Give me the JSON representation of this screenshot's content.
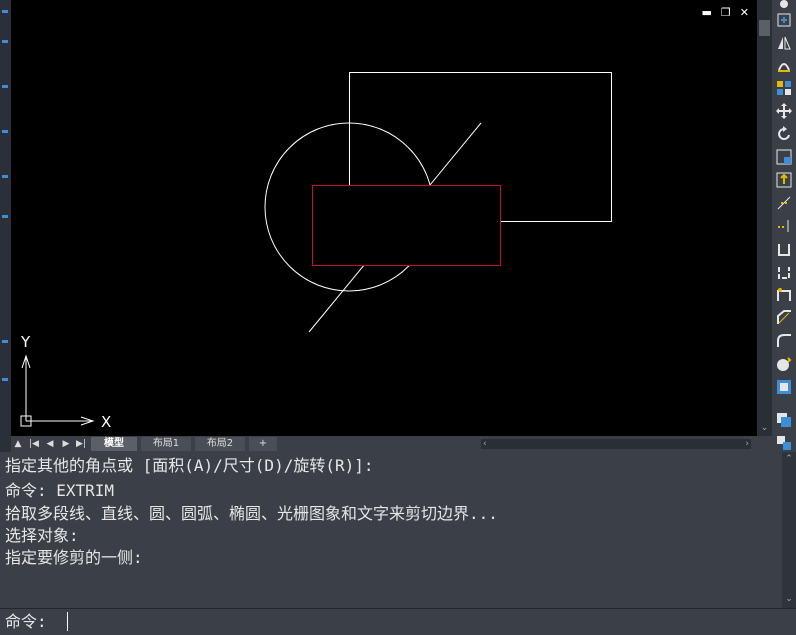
{
  "window_controls": {
    "minimize": "▬",
    "restore": "❐",
    "close": "✕"
  },
  "ucs": {
    "x_label": "X",
    "y_label": "Y"
  },
  "layout_tabs": {
    "nav": [
      "▲",
      "|◀",
      "◀",
      "▶",
      "▶|"
    ],
    "tabs": [
      {
        "label": "模型",
        "active": true
      },
      {
        "label": "布局1",
        "active": false
      },
      {
        "label": "布局2",
        "active": false
      },
      {
        "label": "+",
        "active": false
      }
    ]
  },
  "command_history": [
    "指定其他的角点或 [面积(A)/尺寸(D)/旋转(R)]:",
    "命令: EXTRIM",
    "拾取多段线、直线、圆、圆弧、椭圆、光栅图象和文字来剪切边界...",
    "选择对象:",
    "指定要修剪的一侧:"
  ],
  "command_prompt": "命令:",
  "colors": {
    "drawing_white": "#ffffff",
    "drawing_red": "#c8101e",
    "accent_blue": "#3c8ed6"
  },
  "toolbar_icons": [
    "erase-icon",
    "copy-icon",
    "mirror-icon",
    "offset-icon",
    "array-icon",
    "move-icon",
    "rotate-icon",
    "scale-icon",
    "stretch-icon",
    "trim-icon",
    "extend-icon",
    "break-point-icon",
    "break-icon",
    "join-icon",
    "chamfer-icon",
    "fillet-icon",
    "explode-icon",
    "properties-icon"
  ]
}
